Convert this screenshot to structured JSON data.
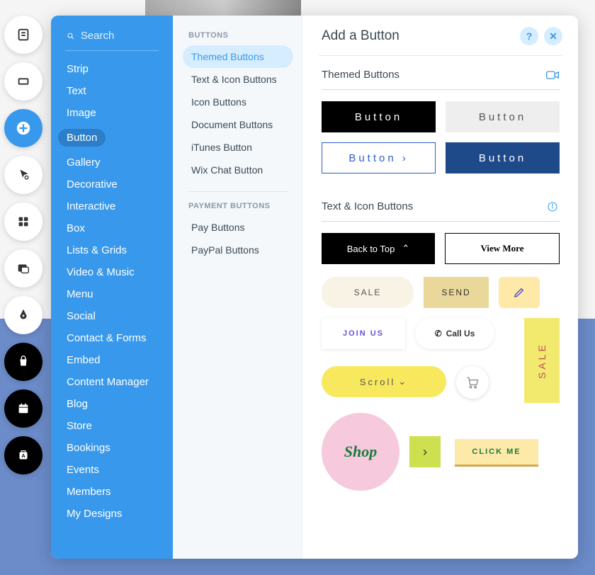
{
  "toolbar": {
    "items": [
      "page-icon",
      "section-icon",
      "add-icon",
      "font-icon",
      "apps-icon",
      "media-icon",
      "pen-icon",
      "store-icon",
      "calendar-icon",
      "ascend-icon"
    ]
  },
  "search": {
    "placeholder": "Search"
  },
  "categories": [
    "Strip",
    "Text",
    "Image",
    "Button",
    "Gallery",
    "Decorative",
    "Interactive",
    "Box",
    "Lists & Grids",
    "Video & Music",
    "Menu",
    "Social",
    "Contact & Forms",
    "Embed",
    "Content Manager",
    "Blog",
    "Store",
    "Bookings",
    "Events",
    "Members",
    "My Designs"
  ],
  "subnav": {
    "heading1": "BUTTONS",
    "group1": [
      "Themed Buttons",
      "Text & Icon Buttons",
      "Icon Buttons",
      "Document Buttons",
      "iTunes Button",
      "Wix Chat Button"
    ],
    "heading2": "PAYMENT BUTTONS",
    "group2": [
      "Pay Buttons",
      "PayPal Buttons"
    ]
  },
  "main": {
    "title": "Add a Button",
    "help": "?",
    "close": "✕",
    "section1": "Themed Buttons",
    "section2": "Text & Icon Buttons",
    "themed": {
      "b1": "Button",
      "b2": "Button",
      "b3": "Button",
      "b4": "Button"
    },
    "ti": {
      "backtop": "Back to Top",
      "viewmore": "View More",
      "sale": "SALE",
      "send": "SEND",
      "joinus": "JOIN US",
      "callus": "Call Us",
      "salevert": "SALE",
      "scroll": "Scroll",
      "shop": "Shop",
      "clickme": "CLICK ME"
    }
  }
}
